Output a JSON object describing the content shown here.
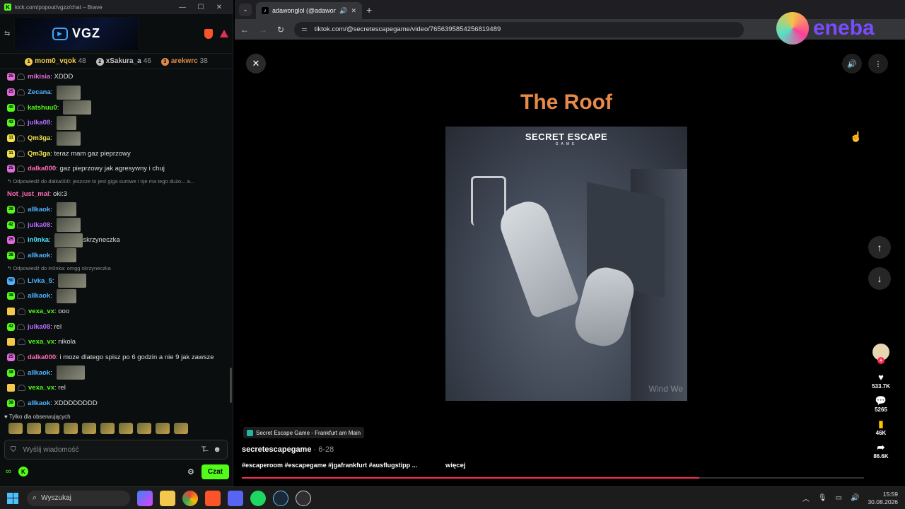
{
  "chat_window": {
    "title": "kick.com/popout/vgzz/chat – Brave",
    "banner_text": "VGZ",
    "leaderboard": [
      {
        "rank": "1",
        "name": "mom0_vqok",
        "count": "48",
        "color": "#f2c94c"
      },
      {
        "rank": "2",
        "name": "xSakura_a",
        "count": "46",
        "color": "#c0c0c0"
      },
      {
        "rank": "3",
        "name": "arekwrc",
        "count": "38",
        "color": "#e08a4a"
      }
    ],
    "messages": [
      {
        "type": "msg",
        "badge": "25",
        "badge_color": "#e16bd9",
        "user": "mikisia",
        "user_color": "#e16bd9",
        "text": "XDDD",
        "emote": false
      },
      {
        "type": "msg",
        "badge": "25",
        "badge_color": "#e16bd9",
        "user": "Zecana",
        "user_color": "#4fb3ff",
        "text": "",
        "emote": true
      },
      {
        "type": "msg",
        "badge": "40",
        "badge_color": "#53fc18",
        "user": "katshuu0",
        "user_color": "#53fc18",
        "text": "",
        "emote": true
      },
      {
        "type": "msg",
        "badge": "42",
        "badge_color": "#53fc18",
        "user": "julka08",
        "user_color": "#b86bff",
        "text": "",
        "emote": true
      },
      {
        "type": "msg",
        "badge": "11",
        "badge_color": "#f2e14c",
        "user": "Qm3ga",
        "user_color": "#f2e14c",
        "text": "",
        "emote": true
      },
      {
        "type": "msg",
        "badge": "11",
        "badge_color": "#f2e14c",
        "user": "Qm3ga",
        "user_color": "#f2e14c",
        "text": "teraz mam gaz pieprzowy",
        "emote": false
      },
      {
        "type": "msg",
        "badge": "25",
        "badge_color": "#e16bd9",
        "user": "dalka000",
        "user_color": "#ff6bb5",
        "text": "gaz pieprzowy jak agresywny i chuj",
        "emote": false
      },
      {
        "type": "reply",
        "text": "Odpowiedź do dalka000: jeszcze to jest giga surowe i nje ma tego dużo... a..."
      },
      {
        "type": "msg",
        "badge": "",
        "badge_color": "",
        "user": "Not_just_mal",
        "user_color": "#ff6bb5",
        "text": "oki:3",
        "emote": false
      },
      {
        "type": "msg",
        "badge": "38",
        "badge_color": "#53fc18",
        "user": "allkaok",
        "user_color": "#4fb3ff",
        "text": "",
        "emote": true
      },
      {
        "type": "msg",
        "badge": "42",
        "badge_color": "#53fc18",
        "user": "julka08",
        "user_color": "#b86bff",
        "text": "",
        "emote": true
      },
      {
        "type": "msg",
        "badge": "25",
        "badge_color": "#e16bd9",
        "user": "in0nka",
        "user_color": "#4fe3ff",
        "text": "skrzyneczka",
        "emote": true
      },
      {
        "type": "msg",
        "badge": "38",
        "badge_color": "#53fc18",
        "user": "allkaok",
        "user_color": "#4fb3ff",
        "text": "",
        "emote": true
      },
      {
        "type": "reply",
        "text": "Odpowiedź do in0nka: omgg skrzyneczka"
      },
      {
        "type": "msg",
        "badge": "50",
        "badge_color": "#4fb3ff",
        "user": "Livka_5",
        "user_color": "#4fb3ff",
        "text": "",
        "emote": true
      },
      {
        "type": "msg",
        "badge": "38",
        "badge_color": "#53fc18",
        "user": "allkaok",
        "user_color": "#4fb3ff",
        "text": "",
        "emote": true
      },
      {
        "type": "msg",
        "badge": "",
        "badge_color": "",
        "user": "vexa_vx",
        "user_color": "#53fc18",
        "text": "ooo",
        "emote": false
      },
      {
        "type": "msg",
        "badge": "42",
        "badge_color": "#53fc18",
        "user": "julka08",
        "user_color": "#b86bff",
        "text": "rel",
        "emote": false
      },
      {
        "type": "msg",
        "badge": "",
        "badge_color": "",
        "user": "vexa_vx",
        "user_color": "#53fc18",
        "text": "nikola",
        "emote": false
      },
      {
        "type": "msg",
        "badge": "25",
        "badge_color": "#e16bd9",
        "user": "dalka000",
        "user_color": "#ff6bb5",
        "text": "i moze dlatego spisz po 6 godzin a nie 9 jak zawsze",
        "emote": false
      },
      {
        "type": "msg",
        "badge": "38",
        "badge_color": "#53fc18",
        "user": "allkaok",
        "user_color": "#4fb3ff",
        "text": "",
        "emote": true
      },
      {
        "type": "msg",
        "badge": "",
        "badge_color": "",
        "user": "vexa_vx",
        "user_color": "#53fc18",
        "text": "rel",
        "emote": false
      },
      {
        "type": "msg",
        "badge": "38",
        "badge_color": "#53fc18",
        "user": "allkaok",
        "user_color": "#4fb3ff",
        "text": "XDDDDDDDD",
        "emote": false
      }
    ],
    "follow_only": "Tylko dla obserwujących",
    "input_placeholder": "Wyślij wiadomość",
    "send_button": "Czat"
  },
  "browser": {
    "tab_title": "adawonglol (@adawonglol)",
    "url": "tiktok.com/@secretescapegame/video/7656395854256819489"
  },
  "video": {
    "title": "The Roof",
    "brand": "SECRET ESCAPE",
    "brand_sub": "GAME",
    "watermark": "Wind We",
    "location_tag": "Secret Escape Game - Frankfurt am Main",
    "author": "secretescapegame",
    "date": " · 6-28",
    "hashtags": "#escaperoom #escapegame #jgafrankfurt #ausflugstipp ...",
    "more_label": "więcej",
    "likes": "533.7K",
    "comments": "5265",
    "saves": "46K",
    "shares": "86.6K",
    "progress_fraction": 0.735
  },
  "overlay": {
    "brand": "eneba"
  },
  "taskbar": {
    "search_label": "Wyszukaj",
    "time": "15:59",
    "date": "30.08.2026"
  }
}
